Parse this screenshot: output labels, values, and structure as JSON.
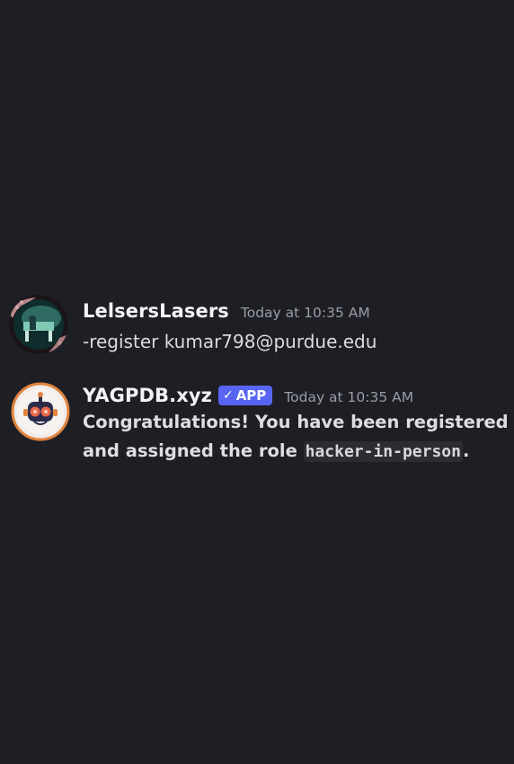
{
  "messages": [
    {
      "username": "LelsersLasers",
      "timestamp": "Today at 10:35 AM",
      "content": "-register kumar798@purdue.edu"
    },
    {
      "username": "YAGPDB.xyz",
      "badge": {
        "check": "✓",
        "label": "APP"
      },
      "timestamp": "Today at 10:35 AM",
      "content_line1": "Congratulations! You have been registered",
      "content_line2_prefix": "and assigned the role ",
      "content_code": "hacker-in-person",
      "content_suffix": "."
    }
  ],
  "colors": {
    "background": "#1e1f25",
    "badge": "#5865f2",
    "timestamp": "#9a9ca6"
  }
}
